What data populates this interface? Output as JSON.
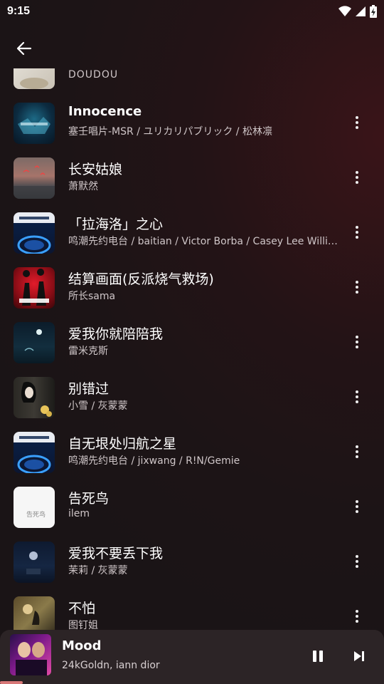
{
  "status_bar": {
    "time": "9:15"
  },
  "songs": [
    {
      "title": "",
      "artist": "DOUDOU",
      "bold": false
    },
    {
      "title": "Innocence",
      "artist": "塞壬唱片-MSR / ユリカリパブリック / 松林凛",
      "bold": true
    },
    {
      "title": "长安姑娘",
      "artist": "萧默然",
      "bold": false
    },
    {
      "title": "「拉海洛」之心",
      "artist": "鸣潮先约电台 / baitian / Victor Borba / Casey Lee Williams",
      "bold": false
    },
    {
      "title": "结算画面(反派烧气救场)",
      "artist": "所长sama",
      "bold": false
    },
    {
      "title": "爱我你就陪陪我",
      "artist": "雷米克斯",
      "bold": false
    },
    {
      "title": "别错过",
      "artist": "小雪 / 灰蒙蒙",
      "bold": false
    },
    {
      "title": "自无垠处归航之星",
      "artist": "鸣潮先约电台 / jixwang / R!N/Gemie",
      "bold": false
    },
    {
      "title": "告死鸟",
      "artist": "ilem",
      "bold": false
    },
    {
      "title": "爱我不要丢下我",
      "artist": "茉莉 / 灰蒙蒙",
      "bold": false
    },
    {
      "title": "不怕",
      "artist": "图钉姐",
      "bold": false
    }
  ],
  "cover_texts": {
    "gaosiniao": "告死鸟"
  },
  "now_playing": {
    "title": "Mood",
    "artist": "24kGoldn, iann dior",
    "progress": 0.06
  },
  "colors": {
    "accent": "#d77777"
  }
}
